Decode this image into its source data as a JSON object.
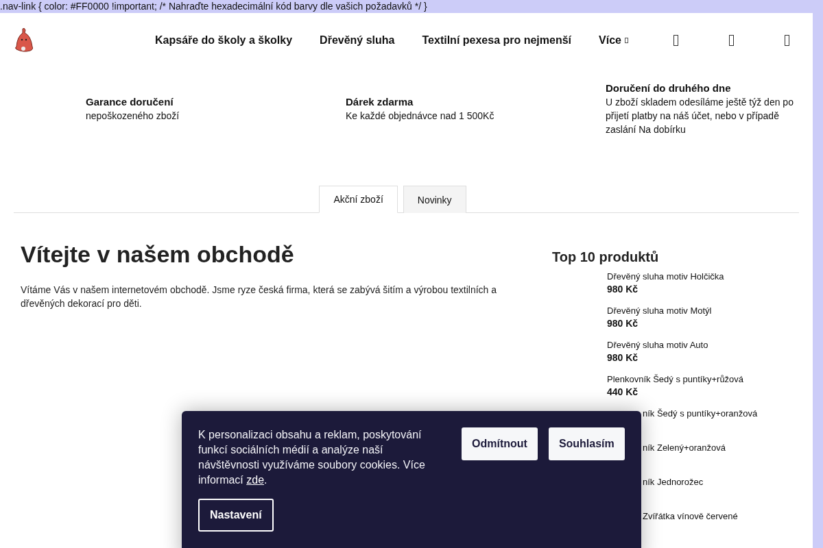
{
  "code_line": ".nav-link { color: #FF0000 !important; /* Nahraďte hexadecimální kód barvy dle vašich požadavků */ }",
  "nav": {
    "items": [
      {
        "label": "Kapsáře do školy a školky",
        "kind": "link"
      },
      {
        "label": "Dřevěný sluha",
        "kind": "link"
      },
      {
        "label": "Textilní pexesa pro nejmenší",
        "kind": "link"
      },
      {
        "label": "Více",
        "kind": "more"
      }
    ]
  },
  "benefits": [
    {
      "title": "Garance doručení",
      "text": "nepoškozeného zboží"
    },
    {
      "title": "Dárek zdarma",
      "text": "Ke každé objednávce nad 1 500Kč"
    },
    {
      "title": "Doručení do druhého dne",
      "text": "U zboží skladem odesíláme ještě týž den po přijetí platby na náš účet, nebo v případě zaslání Na dobírku"
    }
  ],
  "tabs": [
    {
      "label": "Akční zboží",
      "selected": true
    },
    {
      "label": "Novinky",
      "selected": false
    }
  ],
  "welcome": {
    "title": "Vítejte v našem obchodě",
    "text": "Vítáme Vás v našem internetovém obchodě. Jsme ryze česká firma, která se zabývá šitím a výrobou textilních a dřevěných dekorací pro děti."
  },
  "top_products": {
    "title": "Top 10 produktů",
    "items": [
      {
        "name": "Dřevěný sluha motiv Holčička",
        "price": "980 Kč",
        "kind": "full"
      },
      {
        "name": "Dřevěný sluha motiv Motýl",
        "price": "980 Kč",
        "kind": "full"
      },
      {
        "name": "Dřevěný sluha motiv Auto",
        "price": "980 Kč",
        "kind": "full"
      },
      {
        "name": "Plenkovník Šedý s puntíky+růžová",
        "price": "440 Kč",
        "kind": "full"
      },
      {
        "name": "ník Šedý s puntíky+oranžová",
        "kind": "covered"
      },
      {
        "name": "ník Zelený+oranžová",
        "kind": "covered"
      },
      {
        "name": "ník Jednorožec",
        "kind": "covered"
      },
      {
        "name": "Zvířátka vínově červené",
        "kind": "covered"
      }
    ]
  },
  "cookie_banner": {
    "text": "K personalizaci obsahu a reklam, poskytování funkcí sociálních médií a analýze naší návštěvnosti využíváme soubory cookies. Více informací ",
    "link": "zde",
    "after_link": ".",
    "buttons": [
      {
        "label": "Odmítnout",
        "kind": "light"
      },
      {
        "label": "Souhlasím",
        "kind": "light"
      },
      {
        "label": "Nastavení",
        "kind": "outline"
      }
    ]
  }
}
